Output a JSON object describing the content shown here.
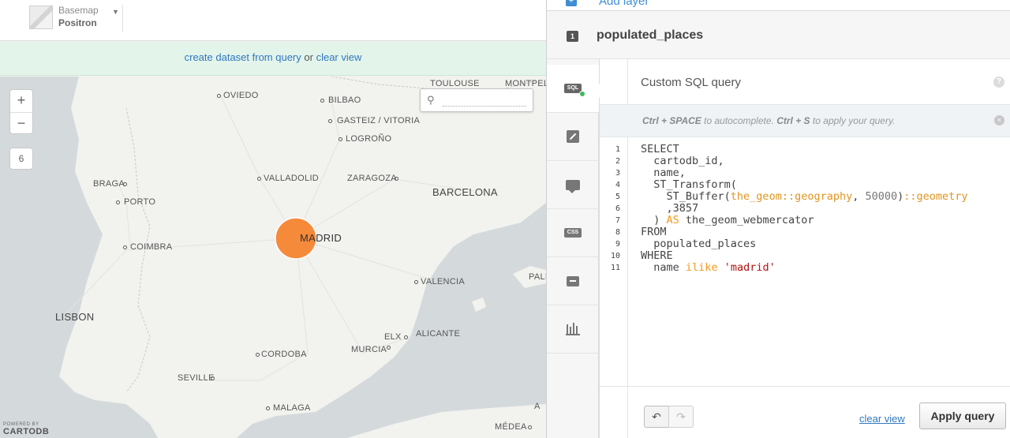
{
  "basemap": {
    "label": "Basemap",
    "value": "Positron"
  },
  "infobar": {
    "create_link": "create dataset from query",
    "or": "or",
    "clear_link": "clear view"
  },
  "map": {
    "zoom_in": "+",
    "zoom_out": "−",
    "zoom_level": "6",
    "search_placeholder": "",
    "powered_by": "POWERED BY",
    "brand": "CARTODB",
    "places": [
      "TOULOUSE",
      "MONTPEL",
      "OVIEDO",
      "BILBAO",
      "GASTEIZ / VITORIA",
      "LOGROÑO",
      "BRAGA",
      "VALLADOLID",
      "ZARAGOZA",
      "BARCELONA",
      "PORTO",
      "MADRID",
      "COIMBRA",
      "VALENCIA",
      "PALM",
      "LISBON",
      "ELX",
      "ALICANTE",
      "MURCIA",
      "CORDOBA",
      "SEVILLE",
      "MALAGA",
      "MÉDEA",
      "A"
    ]
  },
  "panel": {
    "add_layer": "Add layer",
    "add_layer_icon": "+",
    "layer_number": "1",
    "layer_name": "populated_places",
    "tabs": [
      {
        "name": "sql",
        "label": "SQL"
      },
      {
        "name": "wizard",
        "label": ""
      },
      {
        "name": "infowindow",
        "label": ""
      },
      {
        "name": "css",
        "label": "CSS"
      },
      {
        "name": "legends",
        "label": ""
      },
      {
        "name": "filters",
        "label": ""
      }
    ],
    "editor_title": "Custom SQL query",
    "help_icon": "?",
    "hint": {
      "k1": "Ctrl + SPACE",
      "t1": "to autocomplete.",
      "k2": "Ctrl + S",
      "t2": "to apply your query."
    },
    "close_icon": "×",
    "line_numbers": [
      "1",
      "2",
      "3",
      "4",
      "5",
      "6",
      "7",
      "8",
      "9",
      "10",
      "11"
    ],
    "code": {
      "l1": "SELECT",
      "l2": "  cartodb_id,",
      "l3": "  name,",
      "l4": "  ST_Transform(",
      "l5a": "    ST_Buffer(",
      "l5b": "the_geom::geography",
      "l5c": ", ",
      "l5d": "50000",
      "l5e": ")",
      "l5f": "::geometry",
      "l6": "    ,3857",
      "l7a": "  ) ",
      "l7b": "AS",
      "l7c": " the_geom_webmercator",
      "l8": "FROM",
      "l9": "  populated_places",
      "l10": "WHERE",
      "l11a": "  name ",
      "l11b": "ilike",
      "l11c": " ",
      "l11d": "'madrid'"
    },
    "undo_icon": "↶",
    "redo_icon": "↷",
    "clear_view": "clear view",
    "apply": "Apply query"
  },
  "colors": {
    "accent": "#3178c1",
    "keyword": "#f29a1f",
    "string": "#b31212",
    "point": "#f58a3a",
    "infobar": "#e3f4ea"
  }
}
